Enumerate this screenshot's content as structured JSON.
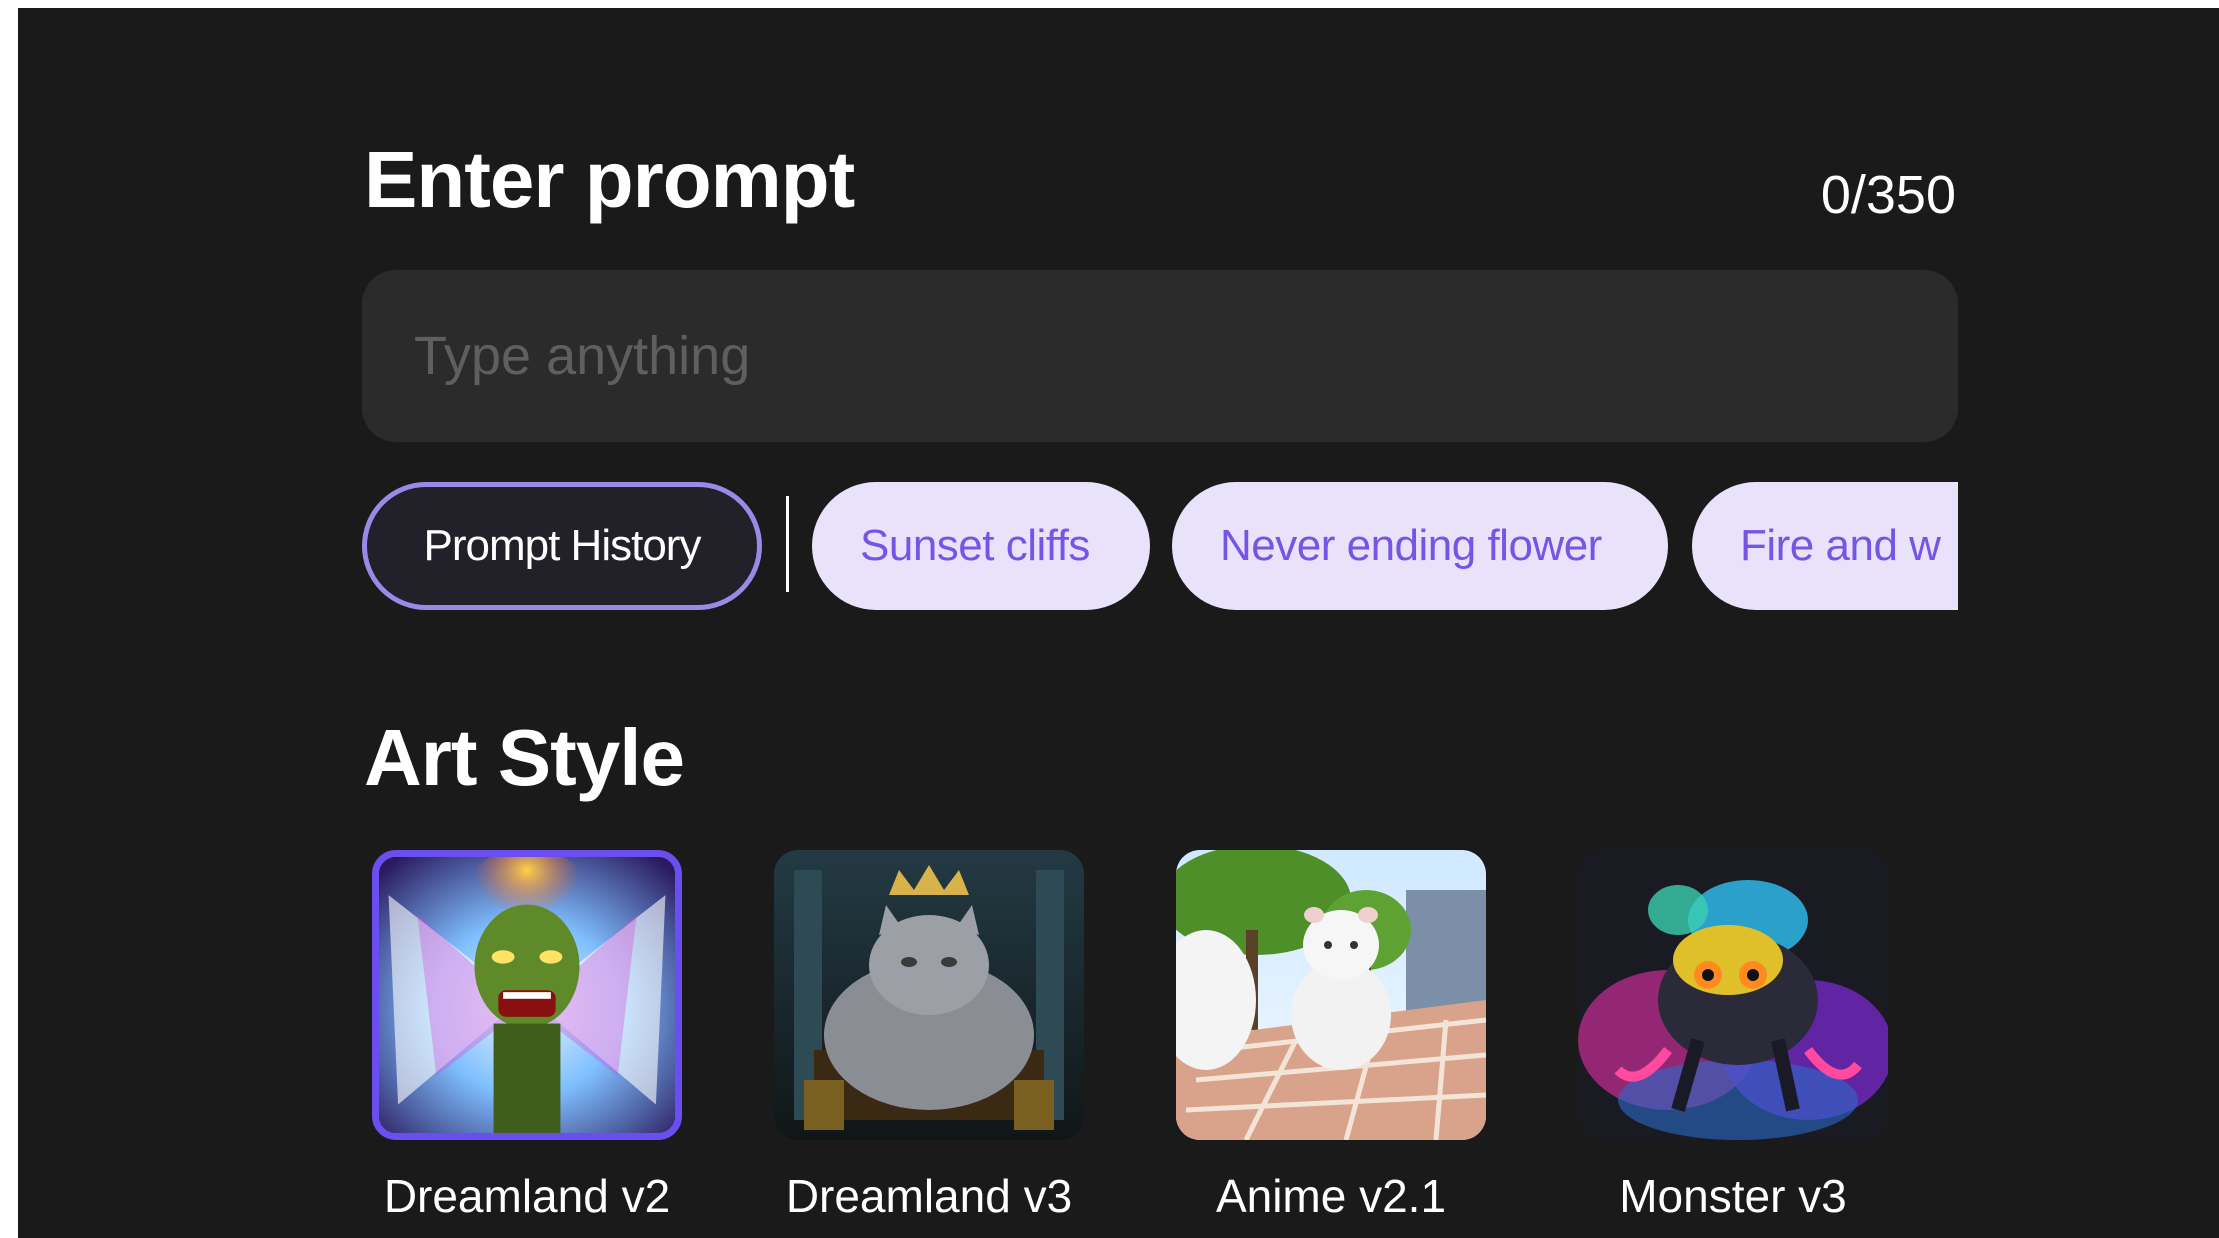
{
  "prompt": {
    "title": "Enter prompt",
    "char_count": "0/350",
    "input_value": "",
    "placeholder": "Type anything"
  },
  "chips": {
    "history_label": "Prompt History",
    "suggestions": [
      "Sunset cliffs",
      "Never ending flower",
      "Fire and w"
    ]
  },
  "art_style": {
    "title": "Art Style",
    "selected": "Dreamland v2",
    "items": [
      {
        "label": "Dreamland v2",
        "selected": true
      },
      {
        "label": "Dreamland v3",
        "selected": false
      },
      {
        "label": "Anime v2.1",
        "selected": false
      },
      {
        "label": "Monster v3",
        "selected": false
      }
    ]
  },
  "colors": {
    "background": "#1a1a1a",
    "input_background": "#2b2b2b",
    "chip_background": "#e8e3fb",
    "chip_text": "#7654e6",
    "accent_border": "#9a8ae8",
    "selected_border": "#6a4ef0"
  }
}
